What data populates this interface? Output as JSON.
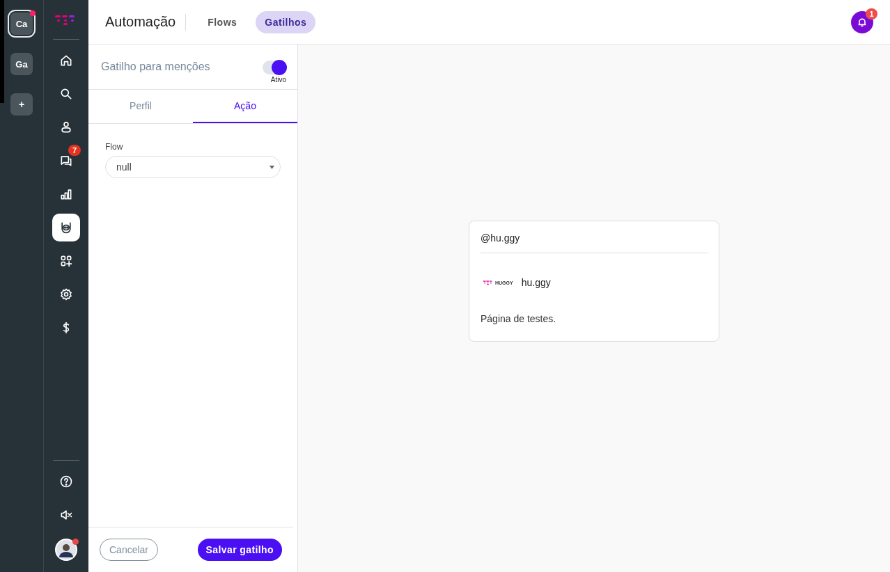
{
  "workspaces": [
    {
      "label": "Ca",
      "selected": true,
      "notification": true
    },
    {
      "label": "Ga",
      "selected": false,
      "notification": false
    }
  ],
  "add_workspace": "+",
  "nav": [
    {
      "kind": "home",
      "selected": false
    },
    {
      "kind": "search",
      "selected": false
    },
    {
      "kind": "user",
      "selected": false
    },
    {
      "kind": "chat",
      "selected": false,
      "badge": "7"
    },
    {
      "kind": "chart",
      "selected": false
    },
    {
      "kind": "bot",
      "selected": true
    },
    {
      "kind": "apps",
      "selected": false
    },
    {
      "kind": "settings",
      "selected": false
    },
    {
      "kind": "dollar",
      "selected": false
    }
  ],
  "nav_bottom": [
    {
      "kind": "help"
    },
    {
      "kind": "mute"
    }
  ],
  "user": {
    "online": true
  },
  "header": {
    "title": "Automação",
    "tabs": [
      {
        "label": "Flows",
        "selected": false
      },
      {
        "label": "Gatilhos",
        "selected": true
      }
    ],
    "notification_count": "1"
  },
  "trigger": {
    "name": "Gatilho para menções",
    "on": true,
    "status": "Ativo",
    "tabs": [
      {
        "label": "Perfil",
        "selected": false
      },
      {
        "label": "Ação",
        "selected": true
      }
    ],
    "field": {
      "label": "Flow",
      "value": "null"
    },
    "buttons": {
      "cancel": "Cancelar",
      "save": "Salvar gatilho"
    }
  },
  "preview": {
    "handle": "@hu.ggy",
    "logo_text": "HUGGY",
    "page_name": "hu.ggy",
    "description": "Página de testes."
  }
}
